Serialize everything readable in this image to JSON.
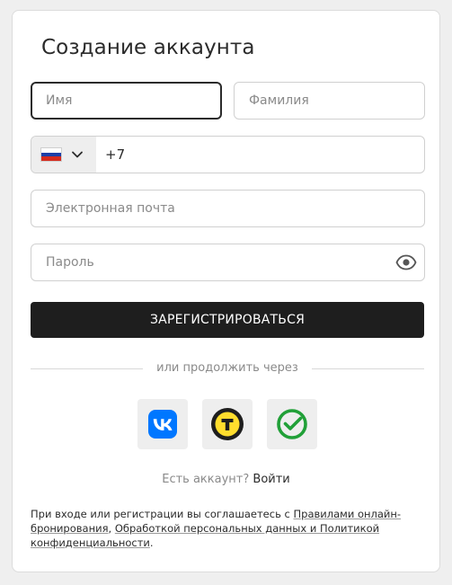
{
  "form": {
    "title": "Создание аккаунта",
    "first_name": {
      "value": "",
      "placeholder": "Имя"
    },
    "last_name": {
      "value": "",
      "placeholder": "Фамилия"
    },
    "phone": {
      "country": "RU",
      "prefix": "+7",
      "value": ""
    },
    "email": {
      "value": "",
      "placeholder": "Электронная почта"
    },
    "password": {
      "value": "",
      "placeholder": "Пароль"
    },
    "submit_label": "ЗАРЕГИСТРИРОВАТЬСЯ",
    "divider_text": "или продолжить через"
  },
  "social": [
    {
      "name": "vk-icon",
      "color": "#0077ff"
    },
    {
      "name": "tinkoff-icon",
      "color": "#ffdd2d"
    },
    {
      "name": "sber-icon",
      "color": "#21a038"
    }
  ],
  "login_prompt": {
    "question": "Есть аккаунт?",
    "link": "Войти"
  },
  "legal": {
    "prefix": "При входе или регистрации вы соглашаетесь с ",
    "rules_link": "Правилами онлайн-бронирования",
    "sep": ", ",
    "privacy_link": "Обработкой персональных данных и Политикой конфиденциальности",
    "suffix": "."
  },
  "colors": {
    "primary_button": "#1e1e1e",
    "flag_white": "#ffffff",
    "flag_blue": "#1c3fa8",
    "flag_red": "#d52b1e"
  }
}
